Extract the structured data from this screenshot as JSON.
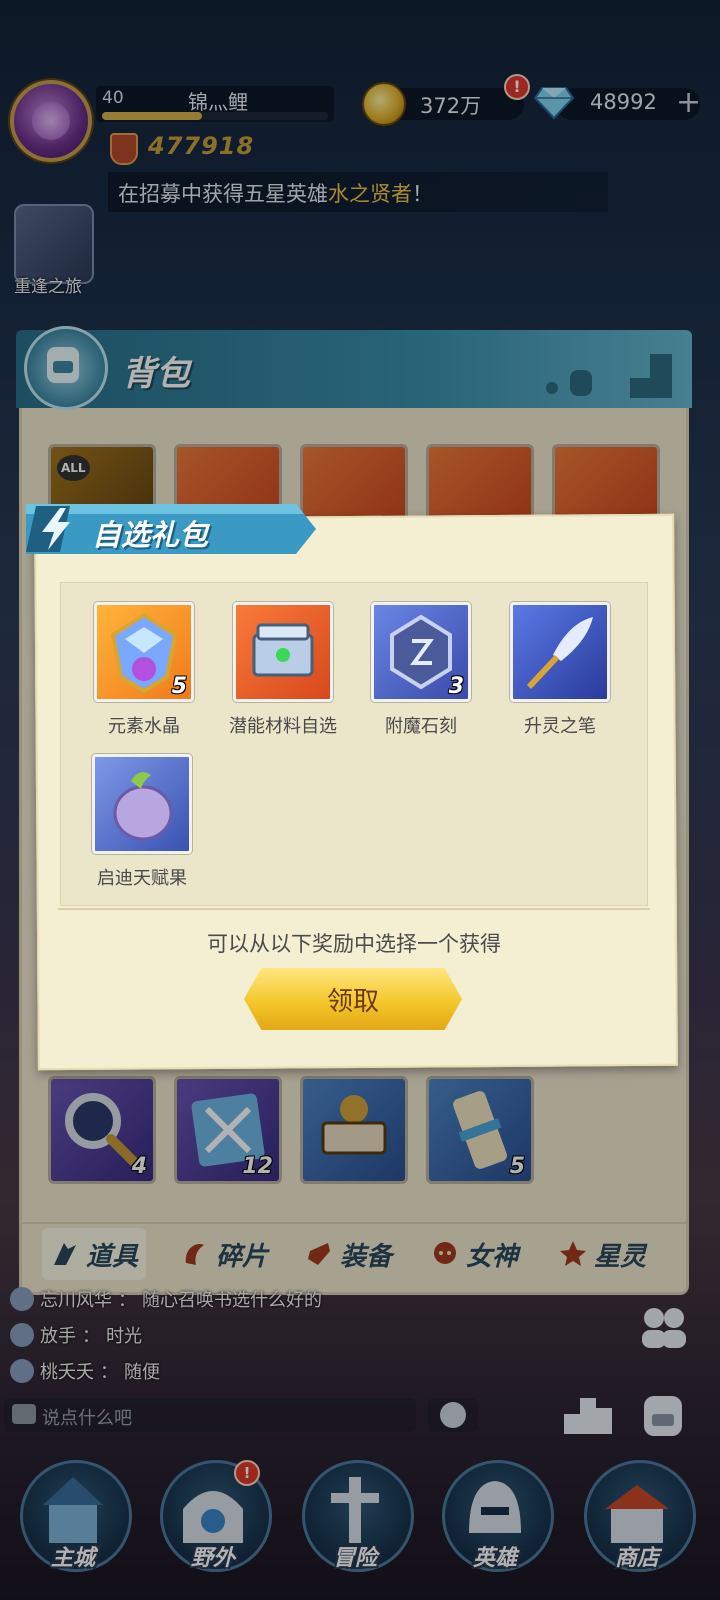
{
  "hud": {
    "level": "40",
    "player_name": "锦灬鲤",
    "power": "477918",
    "coins": "372万",
    "coin_alert": "!",
    "gems": "48992",
    "add_label": "+",
    "ticker_prefix": "在招募中获得五星英雄",
    "ticker_highlight": "水之贤者",
    "ticker_suffix": "！",
    "journey_label": "重逢之旅"
  },
  "bag": {
    "title": "背包",
    "top_row_badges": [
      "ALL"
    ],
    "bottom_row": [
      {
        "name": "magnifier",
        "qty": "4"
      },
      {
        "name": "sword-map",
        "qty": "12"
      },
      {
        "name": "chest-orb",
        "qty": ""
      },
      {
        "name": "scroll",
        "qty": "5"
      }
    ],
    "tabs": [
      {
        "label": "道具",
        "icon": "props-icon",
        "active": true
      },
      {
        "label": "碎片",
        "icon": "shard-icon",
        "active": false
      },
      {
        "label": "装备",
        "icon": "equip-icon",
        "active": false
      },
      {
        "label": "女神",
        "icon": "goddess-icon",
        "active": false
      },
      {
        "label": "星灵",
        "icon": "star-spirit-icon",
        "active": false
      }
    ]
  },
  "dialog": {
    "title": "自选礼包",
    "rewards": [
      {
        "label": "元素水晶",
        "qty": "5",
        "icon": "element-crystal-icon"
      },
      {
        "label": "潜能材料自选",
        "qty": "",
        "icon": "potential-chest-icon"
      },
      {
        "label": "附魔石刻",
        "qty": "3",
        "icon": "enchant-stone-icon"
      },
      {
        "label": "升灵之笔",
        "qty": "",
        "icon": "ascend-pen-icon"
      },
      {
        "label": "启迪天赋果",
        "qty": "",
        "icon": "talent-fruit-icon"
      }
    ],
    "instruction": "可以从以下奖励中选择一个获得",
    "claim_label": "领取"
  },
  "chat": {
    "lines": [
      {
        "user": "忘川风华",
        "text": "随心召唤书选什么好的"
      },
      {
        "user": "放手",
        "text": "时光"
      },
      {
        "user": "桃夭夭",
        "text": "随便"
      }
    ],
    "placeholder": "说点什么吧"
  },
  "nav": {
    "items": [
      {
        "label": "主城",
        "icon": "castle-icon"
      },
      {
        "label": "野外",
        "icon": "wild-portal-icon",
        "alert": "!"
      },
      {
        "label": "冒险",
        "icon": "adventure-icon"
      },
      {
        "label": "英雄",
        "icon": "hero-helmet-icon"
      },
      {
        "label": "商店",
        "icon": "shop-icon"
      }
    ]
  },
  "colors": {
    "header_teal": "#3b8fab",
    "panel_cream": "#efe7cf",
    "claim_yellow": "#f4c72a",
    "ticker_highlight": "#f2c44a",
    "alert_red": "#e03a2a"
  }
}
